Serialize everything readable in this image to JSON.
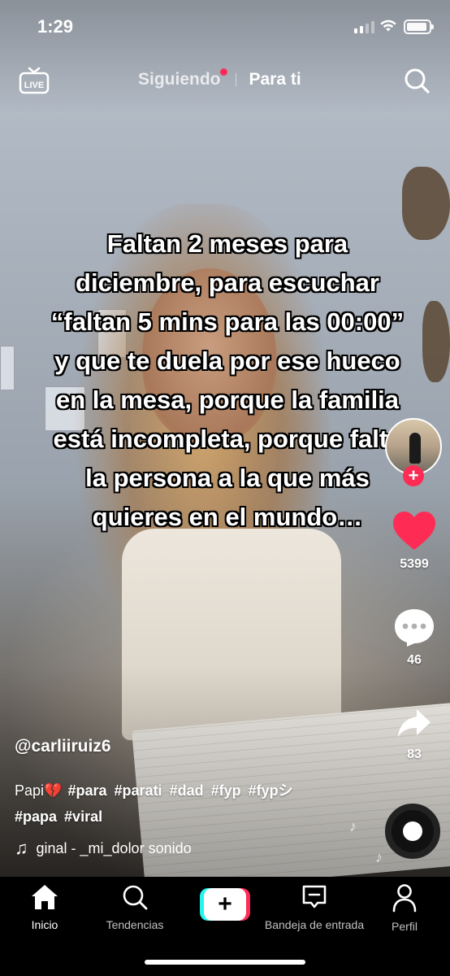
{
  "status_bar": {
    "time": "1:29"
  },
  "top_nav": {
    "live_label": "LIVE",
    "tab_following": "Siguiendo",
    "tab_for_you": "Para ti",
    "search_icon": "search-icon"
  },
  "video": {
    "overlay_text": "Faltan 2 meses para diciembre, para escuchar “faltan 5 mins para las 00:00” y que te duela por ese hueco en la mesa, porque la familia está incompleta, porque falta la persona a la que más quieres en el mundo…",
    "username": "@carliiruiz6",
    "description_text": "Papi",
    "description_emoji": "💔",
    "hashtags": [
      "#para",
      "#parati",
      "#dad",
      "#fyp",
      "#fypシ",
      "#papa",
      "#viral"
    ],
    "music": "ginal - _mi_dolor     sonido"
  },
  "right_rail": {
    "likes": "5399",
    "comments": "46",
    "shares": "83"
  },
  "bottom_nav": {
    "home": "Inicio",
    "discover": "Tendencias",
    "create": "+",
    "inbox": "Bandeja de entrada",
    "profile": "Perfil"
  },
  "colors": {
    "accent_red": "#fe2c55",
    "accent_cyan": "#25f4ee"
  }
}
